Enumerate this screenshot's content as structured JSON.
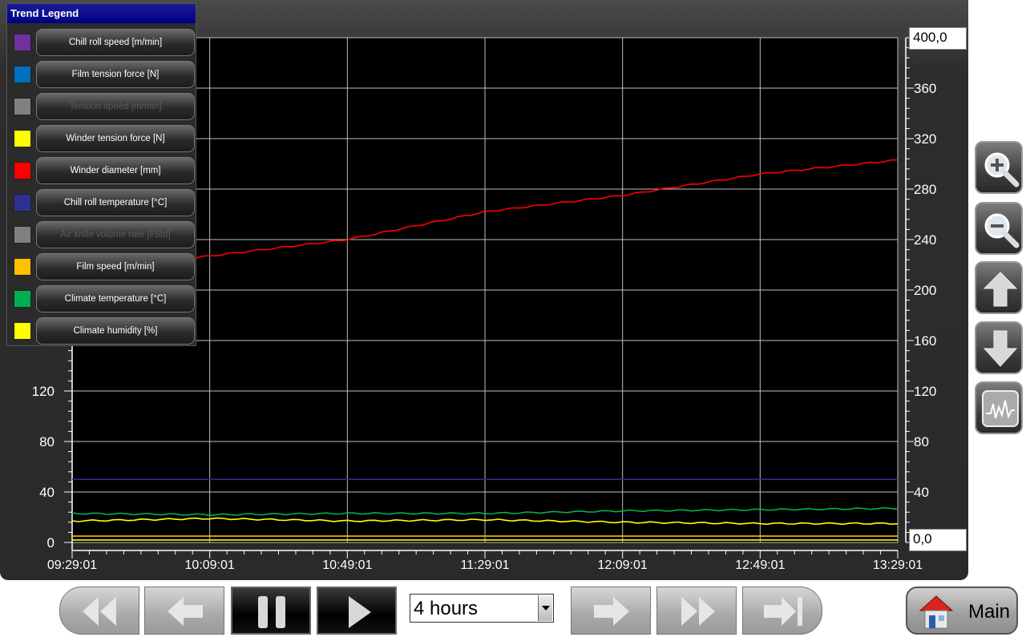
{
  "legend": {
    "title": "Trend Legend",
    "items": [
      {
        "label": "Chill roll speed [m/min]",
        "color": "#7030a0",
        "enabled": true
      },
      {
        "label": "Film tension force [N]",
        "color": "#0070c0",
        "enabled": true
      },
      {
        "label": "Tension speed [m/min]",
        "color": "#808080",
        "enabled": false
      },
      {
        "label": "Winder tension force [N]",
        "color": "#ffff00",
        "enabled": true
      },
      {
        "label": "Winder diameter [mm]",
        "color": "#ff0000",
        "enabled": true
      },
      {
        "label": "Chill roll temperature [°C]",
        "color": "#2e3192",
        "enabled": true
      },
      {
        "label": "Air knife volume rate [l/Std]",
        "color": "#808080",
        "enabled": false
      },
      {
        "label": "Film speed [m/min]",
        "color": "#ffc000",
        "enabled": true
      },
      {
        "label": "Climate temperature [°C]",
        "color": "#00b050",
        "enabled": true
      },
      {
        "label": "Climate humidity [%]",
        "color": "#ffff00",
        "enabled": true
      }
    ]
  },
  "axes": {
    "y_max_input": "400,0",
    "y_min_input": "0,0",
    "left_ticks": [
      "0",
      "40",
      "80",
      "120"
    ],
    "right_ticks": [
      "40",
      "80",
      "120",
      "160",
      "200",
      "240",
      "280",
      "320",
      "360"
    ],
    "time_labels": [
      "09:29:01",
      "10:09:01",
      "10:49:01",
      "11:29:01",
      "12:09:01",
      "12:49:01",
      "13:29:01"
    ]
  },
  "chart_data": {
    "type": "line",
    "x": [
      "09:29:01",
      "10:09:01",
      "10:49:01",
      "11:29:01",
      "12:09:01",
      "12:49:01",
      "13:29:01"
    ],
    "ylim": [
      0,
      400
    ],
    "grid": true,
    "series": [
      {
        "name": "Winder diameter [mm]",
        "color": "#ff0000",
        "values": [
          216,
          227,
          240,
          262,
          275,
          292,
          303
        ]
      },
      {
        "name": "Chill roll temperature [°C]",
        "color": "#2e3192",
        "values": [
          50,
          50,
          50,
          50,
          50,
          50,
          50
        ]
      },
      {
        "name": "Climate temperature [°C]",
        "color": "#00b050",
        "values": [
          23,
          22,
          23,
          23,
          25,
          26,
          27
        ]
      },
      {
        "name": "Climate humidity [%]",
        "color": "#ffff00",
        "values": [
          17,
          19,
          17,
          18,
          16,
          15,
          15
        ]
      },
      {
        "name": "Film speed [m/min]",
        "color": "#ffc000",
        "values": [
          5,
          5,
          5,
          5,
          5,
          5,
          5
        ]
      },
      {
        "name": "Winder tension force [N]",
        "color": "#ffff00",
        "values": [
          2,
          2,
          2,
          2,
          2,
          2,
          2
        ]
      }
    ]
  },
  "side_buttons": [
    "zoom-in-icon",
    "zoom-out-icon",
    "arrow-up-icon",
    "arrow-down-icon",
    "trend-wave-icon"
  ],
  "bottom": {
    "time_range": "4 hours",
    "main_label": "Main"
  }
}
